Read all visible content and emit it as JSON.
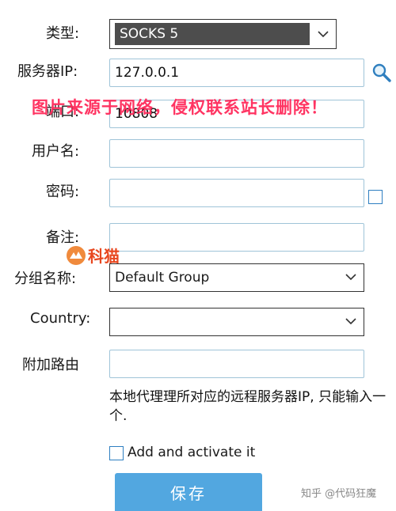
{
  "form": {
    "type": {
      "label": "类型:",
      "value": "SOCKS 5"
    },
    "server_ip": {
      "label": "服务器IP:",
      "value": "127.0.0.1"
    },
    "port": {
      "label": "端口:",
      "value": "10808"
    },
    "username": {
      "label": "用户名:",
      "value": ""
    },
    "password": {
      "label": "密码:",
      "value": ""
    },
    "remark": {
      "label": "备注:",
      "value": ""
    },
    "group": {
      "label": "分组名称:",
      "value": "Default Group"
    },
    "country": {
      "label": "Country:",
      "value": ""
    },
    "extra_route": {
      "label": "附加路由",
      "value": ""
    },
    "description": "本地代理理所对应的远程服务器IP, 只能输入一个.",
    "add_activate_label": "Add and activate it",
    "save_label": "保存"
  },
  "watermark": {
    "notice": "图片来源于网络，侵权联系站长删除！",
    "logo_text": "科猫",
    "credit": "知乎 @代码狂魔"
  },
  "icons": {
    "search": "search-icon",
    "dropdown": "chevron-down-icon"
  },
  "colors": {
    "accent": "#52a7e0",
    "field_border": "#9fc4d8",
    "watermark": "#ff2a5a",
    "logo": "#e8471f"
  }
}
